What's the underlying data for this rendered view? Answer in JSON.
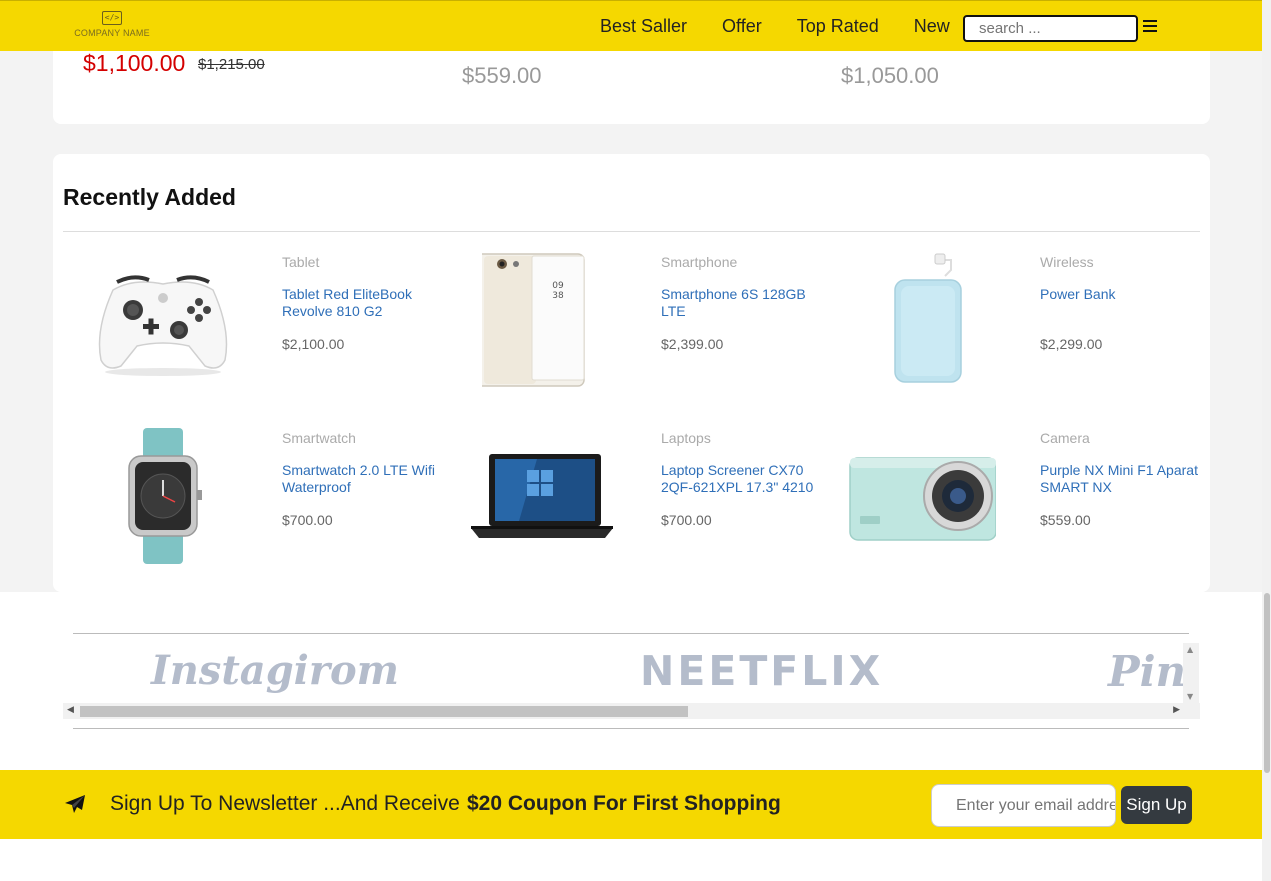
{
  "header": {
    "logo_text": "COMPANY NAME",
    "logo_mark": "</>",
    "nav": [
      "Best Saller",
      "Offer",
      "Top Rated",
      "New"
    ],
    "search_placeholder": "search ...",
    "menu_icon": "hamburger-icon",
    "background": "#f5d800"
  },
  "top_prices": {
    "sale_price": "$1,100.00",
    "old_price": "$1,215.00",
    "price_2": "$559.00",
    "price_3": "$1,050.00"
  },
  "recently_added": {
    "title": "Recently Added",
    "products": [
      {
        "category": "Tablet",
        "title": "Tablet Red EliteBook Revolve 810 G2",
        "price": "$2,100.00",
        "image": "game-controller"
      },
      {
        "category": "Smartphone",
        "title": "Smartphone 6S 128GB LTE",
        "price": "$2,399.00",
        "image": "smartphone"
      },
      {
        "category": "Wireless",
        "title": "Power Bank",
        "price": "$2,299.00",
        "image": "power-bank"
      },
      {
        "category": "Smartwatch",
        "title": "Smartwatch 2.0 LTE Wifi Waterproof",
        "price": "$700.00",
        "image": "smartwatch"
      },
      {
        "category": "Laptops",
        "title": "Laptop Screener CX70 2QF-621XPL 17.3\" 4210",
        "price": "$700.00",
        "image": "laptop"
      },
      {
        "category": "Camera",
        "title": "Purple NX Mini F1 Aparat SMART NX",
        "price": "$559.00",
        "image": "camera"
      }
    ]
  },
  "brands": [
    "Instagirom",
    "NEETFLIX",
    "Pin"
  ],
  "newsletter": {
    "text": "Sign Up To Newsletter ...And Receive",
    "coupon": "$20 Coupon For First Shopping",
    "email_placeholder": "Enter your email address",
    "button_label": "Sign Up",
    "icon": "paper-plane-icon"
  },
  "colors": {
    "accent": "#f5d800",
    "sale": "#d40000",
    "link": "#2f6fb8",
    "button": "#343a40"
  }
}
